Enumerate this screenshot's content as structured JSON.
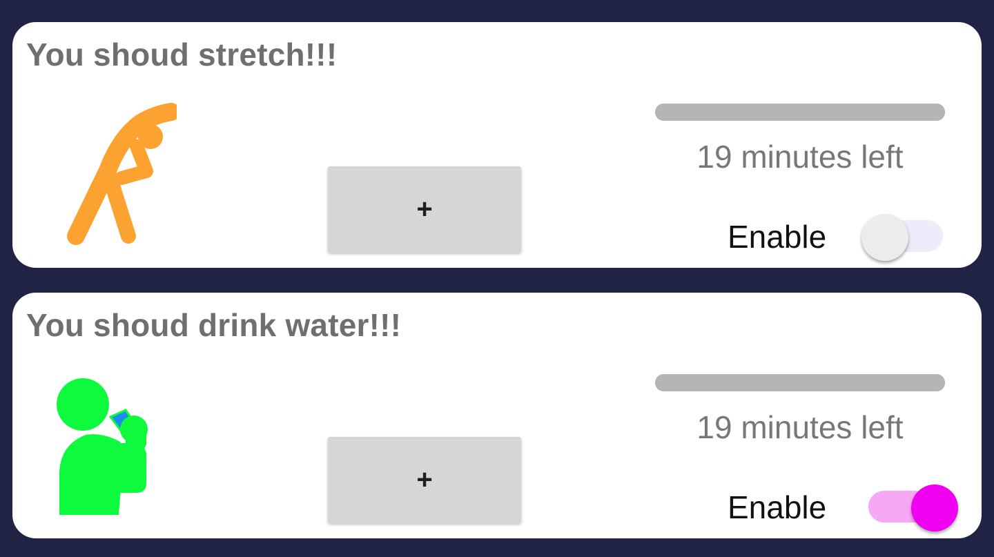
{
  "colors": {
    "background": "#212344",
    "card": "#ffffff",
    "title_text": "#6f6f6f",
    "progress_track": "#b5b5b5",
    "stretch_icon": "#fba231",
    "water_icon": "#0dfb3c",
    "water_cup": "#1a8ef0",
    "switch_on_thumb": "#f000f0",
    "switch_on_track": "#f6a8f6",
    "switch_off_thumb": "#ececec",
    "switch_off_track": "#ececfa"
  },
  "reminders": [
    {
      "title": "You shoud stretch!!!",
      "icon": "stretch-person-icon",
      "add_label": "+",
      "progress_fraction": 1.0,
      "time_left": "19 minutes left",
      "toggle_label": "Enable",
      "enabled": false
    },
    {
      "title": "You shoud drink water!!!",
      "icon": "drinking-water-person-icon",
      "add_label": "+",
      "progress_fraction": 1.0,
      "time_left": "19 minutes left",
      "toggle_label": "Enable",
      "enabled": true
    }
  ]
}
